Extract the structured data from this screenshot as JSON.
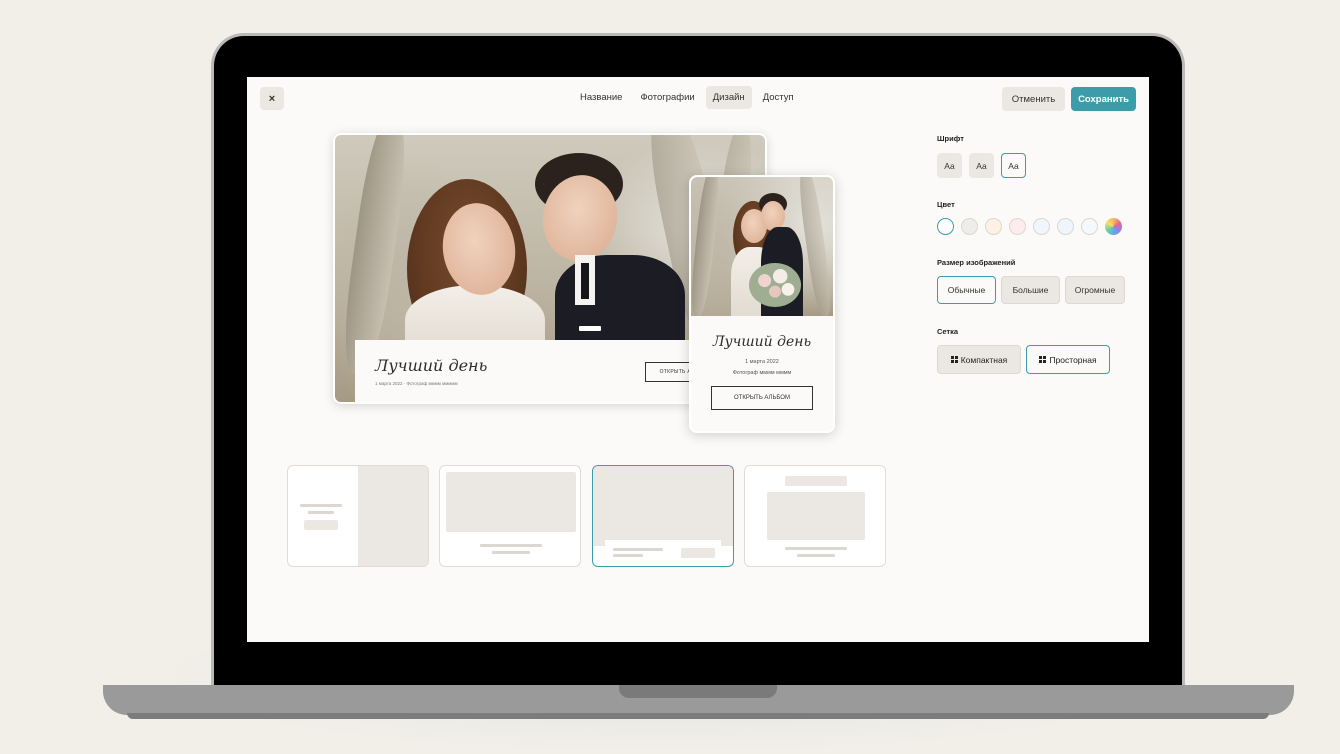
{
  "header": {
    "close_icon": "×",
    "tabs": [
      {
        "label": "Название",
        "active": false
      },
      {
        "label": "Фотографии",
        "active": false
      },
      {
        "label": "Дизайн",
        "active": true
      },
      {
        "label": "Доступ",
        "active": false
      }
    ],
    "cancel_label": "Отменить",
    "save_label": "Сохранить"
  },
  "preview": {
    "title": "Лучший день",
    "subtitle": "1 марта 2022 · Фотограф мммм ммммм",
    "button_label": "ОТКРЫТЬ АЛЬБОМ",
    "mobile_date": "1 марта 2022",
    "mobile_photographer": "Фотограф мммм мммм"
  },
  "settings": {
    "font_label": "Шрифт",
    "font_options": [
      "Aa",
      "Aa",
      "Aa"
    ],
    "font_selected": 2,
    "color_label": "Цвет",
    "colors": [
      "#ffffff",
      "#eeedeb",
      "#fdf1e3",
      "#fdeced",
      "#eff6fd",
      "#eef5fd",
      "#f3f9fd",
      "rainbow"
    ],
    "color_selected": 0,
    "size_label": "Размер изображений",
    "size_options": [
      "Обычные",
      "Большие",
      "Огромные"
    ],
    "size_selected": 0,
    "grid_label": "Сетка",
    "grid_options": [
      "Компактная",
      "Просторная"
    ],
    "grid_selected": 1
  },
  "layouts": {
    "selected": 2
  },
  "colors": {
    "accent": "#3c9caa",
    "background": "#f2efe8",
    "screen": "#fbfaf8"
  }
}
